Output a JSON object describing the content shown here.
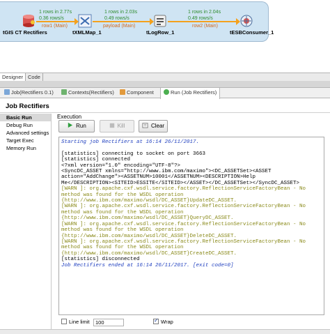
{
  "designer": {
    "components": [
      {
        "label": "tGIS CT Rectifiers",
        "icon": "database-icon"
      },
      {
        "label": "tXMLMap_1",
        "icon": "xml-map-icon"
      },
      {
        "label": "tLogRow_1",
        "icon": "log-row-icon"
      },
      {
        "label": "tESBConsumer_1",
        "icon": "esb-consumer-icon"
      }
    ],
    "flows": [
      {
        "rows": "1 rows in 2.77s",
        "rate": "0.36 rows/s",
        "name": "row1 (Main)"
      },
      {
        "rows": "1 rows in 2.03s",
        "rate": "0.49 rows/s",
        "name": "payload (Main)"
      },
      {
        "rows": "1 rows in 2.04s",
        "rate": "0.49 rows/s",
        "name": "row2 (Main)"
      }
    ],
    "flow_color": "#f4a11d"
  },
  "editor_tabs": [
    "Designer",
    "Code"
  ],
  "view_tabs": [
    {
      "label": "Job(Rectifiers 0.1)",
      "icon": "job-icon"
    },
    {
      "label": "Contexts(Rectifiers)",
      "icon": "contexts-icon"
    },
    {
      "label": "Component",
      "icon": "component-icon"
    },
    {
      "label": "Run (Job Rectifiers)",
      "icon": "run-icon"
    }
  ],
  "view_title": "Job Rectifiers",
  "left_nav": [
    "Basic Run",
    "Debug Run",
    "Advanced settings",
    "Target Exec",
    "Memory Run"
  ],
  "execution": {
    "label": "Execution",
    "run_label": "Run",
    "kill_label": "Kill",
    "clear_label": "Clear"
  },
  "console_lines": [
    {
      "style": "blue",
      "text": "Starting job Rectifiers at 16:14 26/11/2017."
    },
    {
      "style": "norm",
      "text": ""
    },
    {
      "style": "norm",
      "text": "[statistics] connecting to socket on port 3663"
    },
    {
      "style": "norm",
      "text": "[statistics] connected"
    },
    {
      "style": "norm",
      "text": "<?xml version=\"1.0\" encoding=\"UTF-8\"?>"
    },
    {
      "style": "norm",
      "text": "<SyncDC_ASSET xmlns=\"http://www.ibm.com/maximo\"><DC_ASSETSet><ASSET"
    },
    {
      "style": "norm",
      "text": "action=\"AddChange\"><ASSETNUM>10001</ASSETNUM><DESCRIPTION>Help"
    },
    {
      "style": "norm",
      "text": "Me</DESCRIPTION><SITEID>ESSITE</SITEID></ASSET></DC_ASSETSet></SyncDC_ASSET>"
    },
    {
      "style": "warn",
      "text": "[WARN ]: org.apache.cxf.wsdl.service.factory.ReflectionServiceFactoryBean - No"
    },
    {
      "style": "warn",
      "text": "method was found for the WSDL operation"
    },
    {
      "style": "warn",
      "text": "{http://www.ibm.com/maximo/wsdl/DC_ASSET}UpdateDC_ASSET."
    },
    {
      "style": "warn",
      "text": "[WARN ]: org.apache.cxf.wsdl.service.factory.ReflectionServiceFactoryBean - No"
    },
    {
      "style": "warn",
      "text": "method was found for the WSDL operation"
    },
    {
      "style": "warn",
      "text": "{http://www.ibm.com/maximo/wsdl/DC_ASSET}QueryDC_ASSET."
    },
    {
      "style": "warn",
      "text": "[WARN ]: org.apache.cxf.wsdl.service.factory.ReflectionServiceFactoryBean - No"
    },
    {
      "style": "warn",
      "text": "method was found for the WSDL operation"
    },
    {
      "style": "warn",
      "text": "{http://www.ibm.com/maximo/wsdl/DC_ASSET}DeleteDC_ASSET."
    },
    {
      "style": "warn",
      "text": "[WARN ]: org.apache.cxf.wsdl.service.factory.ReflectionServiceFactoryBean - No"
    },
    {
      "style": "warn",
      "text": "method was found for the WSDL operation"
    },
    {
      "style": "warn",
      "text": "{http://www.ibm.com/maximo/wsdl/DC_ASSET}CreateDC_ASSET."
    },
    {
      "style": "norm",
      "text": "[statistics] disconnected"
    },
    {
      "style": "blue",
      "text": "Job Rectifiers ended at 16:14 26/11/2017. [exit code=0]"
    }
  ],
  "footer": {
    "line_limit_label": "Line limit",
    "line_limit_checked": false,
    "line_limit_value": "100",
    "wrap_label": "Wrap",
    "wrap_checked": true
  }
}
